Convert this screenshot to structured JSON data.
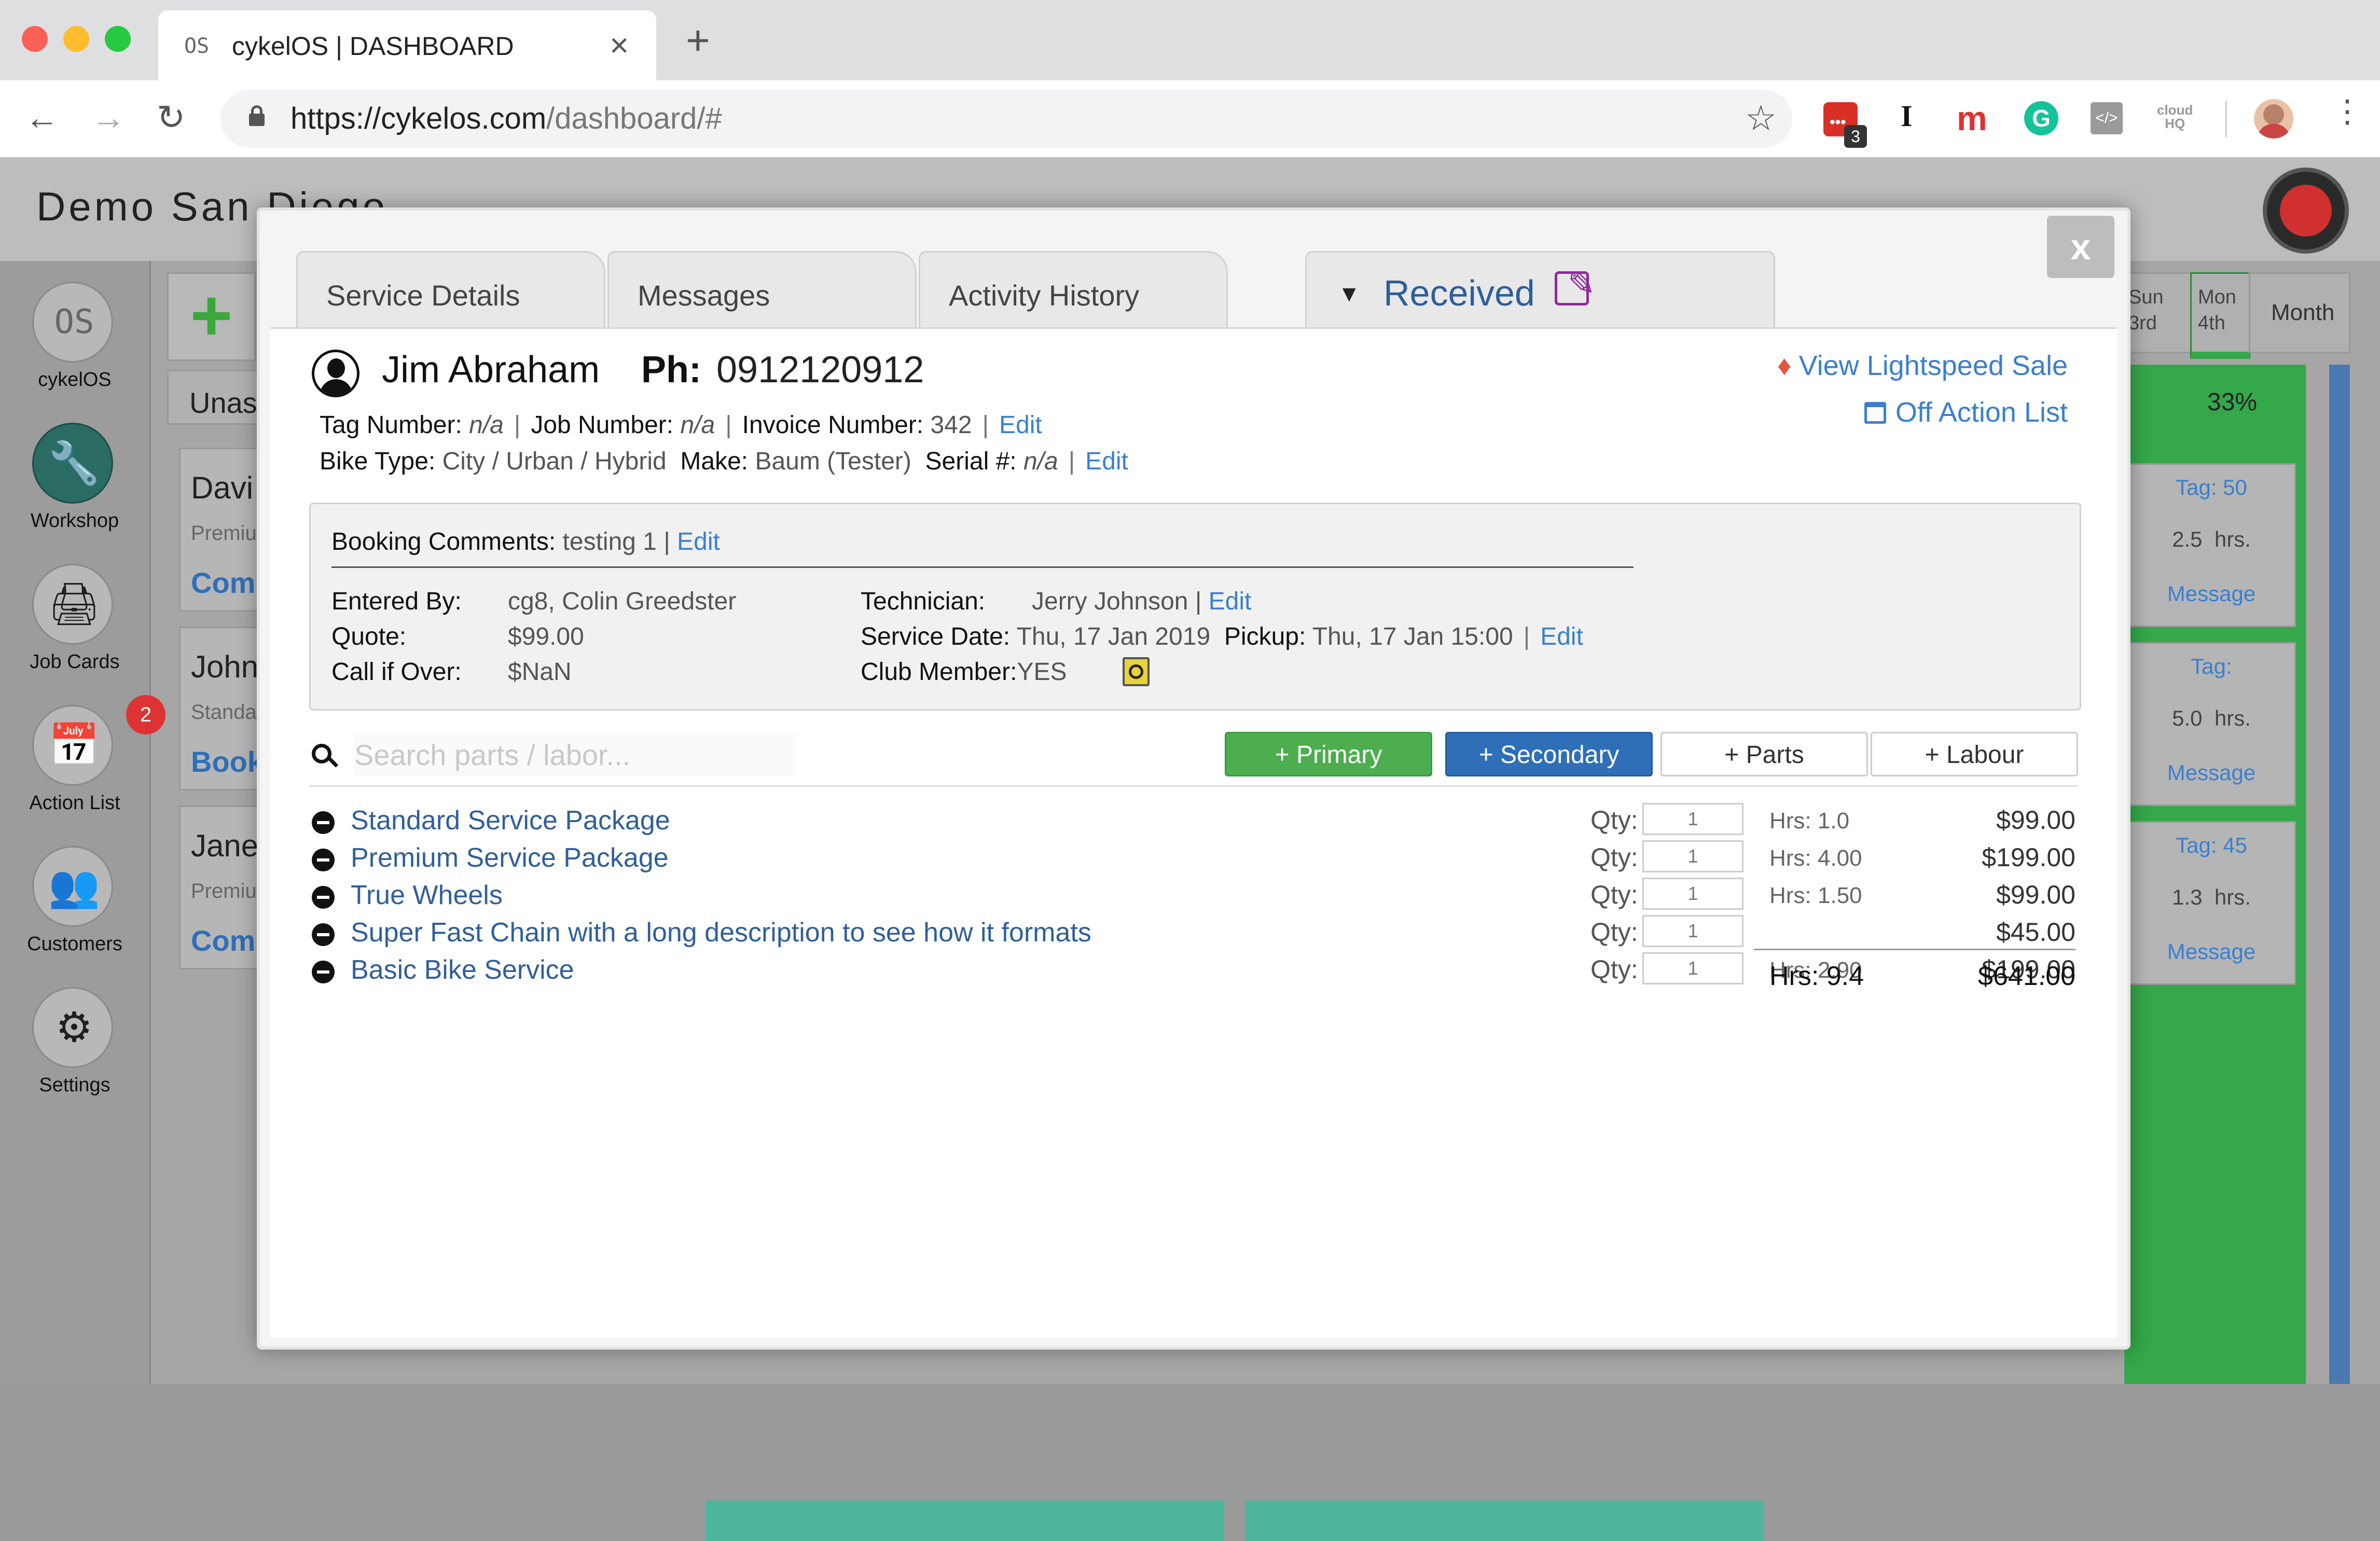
{
  "browser": {
    "tab_favicon": "OS",
    "tab_title": "cykelOS | DASHBOARD",
    "tab_close": "×",
    "new_tab": "+",
    "url_host": "https://cykelos.com",
    "url_path": "/dashboard/#",
    "ext_badge_count": "3",
    "extensions": [
      "todoist-icon",
      "instapaper-icon",
      "mention-icon",
      "grammarly-icon",
      "dev-tools-icon",
      "cloudhq-icon",
      "profile-avatar"
    ]
  },
  "app": {
    "shop_name": "Demo San Diego",
    "sidebar": [
      {
        "label": "cykelOS",
        "icon": "os-logo-icon",
        "glyph": "OS"
      },
      {
        "label": "Workshop",
        "icon": "wrench-icon",
        "glyph": "🔧"
      },
      {
        "label": "Job Cards",
        "icon": "printer-icon",
        "glyph": "🖨"
      },
      {
        "label": "Action List",
        "icon": "calendar-check-icon",
        "glyph": "📅",
        "badge": "2"
      },
      {
        "label": "Customers",
        "icon": "users-icon",
        "glyph": "👥"
      },
      {
        "label": "Settings",
        "icon": "gear-icon",
        "glyph": "⚙"
      }
    ],
    "background": {
      "column_header": "Unas",
      "cards": [
        {
          "name": "Davi",
          "sub": "Premiu",
          "action": "Com"
        },
        {
          "name": "John",
          "sub": "Standa",
          "action": "Book"
        },
        {
          "name": "Jane",
          "sub": "Premiu",
          "action": "Com"
        }
      ],
      "calendar": {
        "tabs": [
          "Sun 3rd",
          "Mon 4th",
          "Month"
        ],
        "progress": "33%",
        "cards": [
          {
            "tag": "Tag: 50",
            "hrs": "2.5  hrs.",
            "action": "Message"
          },
          {
            "tag": "Tag:",
            "hrs": "5.0  hrs.",
            "action": "Message"
          },
          {
            "tag": "Tag: 45",
            "hrs": "1.3  hrs.",
            "action": "Message"
          }
        ]
      }
    }
  },
  "modal": {
    "close_label": "x",
    "tabs": [
      "Service Details",
      "Messages",
      "Activity History"
    ],
    "status": "Received",
    "customer": {
      "name": "Jim Abraham",
      "phone_label": "Ph:",
      "phone": "0912120912"
    },
    "links": {
      "lightspeed": "View Lightspeed Sale",
      "off_action": "Off Action List"
    },
    "job": {
      "tag_label": "Tag Number:",
      "tag": "n/a",
      "job_label": "Job Number:",
      "job": "n/a",
      "invoice_label": "Invoice Number:",
      "invoice": "342",
      "edit": "Edit",
      "bike_type_label": "Bike Type:",
      "bike_type": "City / Urban / Hybrid",
      "make_label": "Make:",
      "make": "Baum (Tester)",
      "serial_label": "Serial #:",
      "serial": "n/a"
    },
    "booking": {
      "comments_label": "Booking Comments:",
      "comments": "testing 1",
      "entered_by_label": "Entered By:",
      "entered_by": "cg8, Colin Greedster",
      "quote_label": "Quote:",
      "quote": "$99.00",
      "call_label": "Call if Over:",
      "call": "$NaN",
      "tech_label": "Technician:",
      "tech": "Jerry Johnson",
      "service_date_label": "Service Date:",
      "service_date": "Thu, 17 Jan 2019",
      "pickup_label": "Pickup:",
      "pickup": "Thu, 17 Jan 15:00",
      "club_label": "Club Member:",
      "club": "YES"
    },
    "search": {
      "placeholder": "Search parts / labor..."
    },
    "buttons": {
      "primary": "+ Primary",
      "secondary": "+ Secondary",
      "parts": "+ Parts",
      "labour": "+ Labour"
    },
    "qty_label": "Qty:",
    "items": [
      {
        "name": "Standard Service Package",
        "qty": "1",
        "hrs": "Hrs: 1.0",
        "price": "$99.00"
      },
      {
        "name": "Premium Service Package",
        "qty": "1",
        "hrs": "Hrs: 4.00",
        "price": "$199.00"
      },
      {
        "name": "True Wheels",
        "qty": "1",
        "hrs": "Hrs: 1.50",
        "price": "$99.00"
      },
      {
        "name": "Super Fast Chain with a long description to see how it formats",
        "qty": "1",
        "hrs": "",
        "price": "$45.00"
      },
      {
        "name": "Basic Bike Service",
        "qty": "1",
        "hrs": "Hrs: 2.90",
        "price": "$199.00"
      }
    ],
    "totals": {
      "hrs": "Hrs: 9.4",
      "price": "$641.00"
    }
  },
  "colors": {
    "link": "#3a7fd0",
    "status": "#2e5d9a",
    "primary_btn": "#4cae4f",
    "secondary_btn": "#2e6fb7",
    "workshop_active": "#2a6b63",
    "badge": "#dd3333",
    "edit_icon": "#8e2a9a"
  }
}
